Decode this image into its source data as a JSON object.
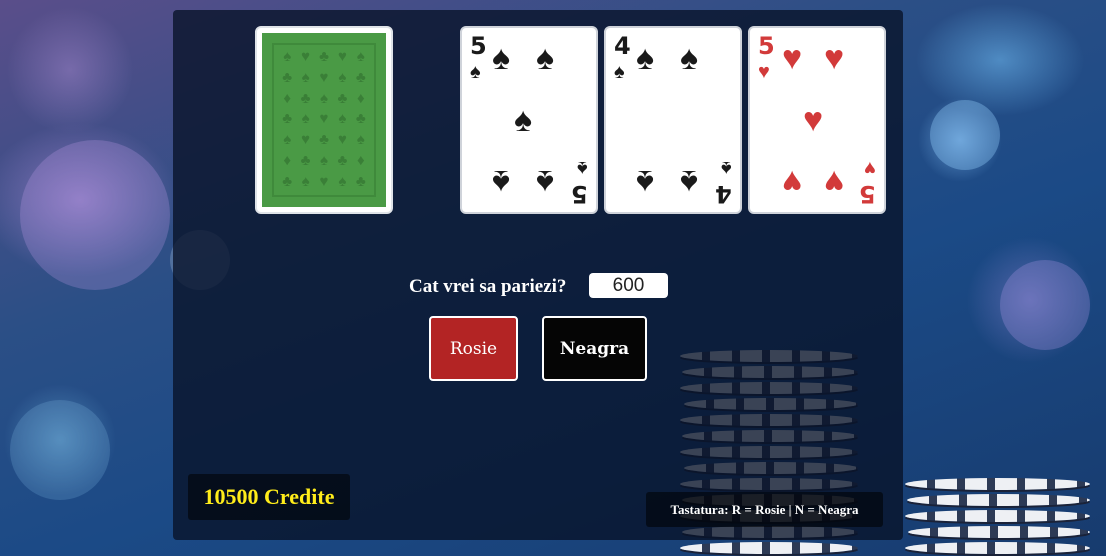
{
  "cards": [
    {
      "id": "back",
      "face_down": true
    },
    {
      "rank": "5",
      "suit": "spades",
      "suit_symbol": "♠",
      "color": "#1a1a1a"
    },
    {
      "rank": "4",
      "suit": "spades",
      "suit_symbol": "♠",
      "color": "#1a1a1a"
    },
    {
      "rank": "5",
      "suit": "hearts",
      "suit_symbol": "♥",
      "color": "#d23a3a"
    }
  ],
  "bet": {
    "label": "Cat vrei sa pariezi?",
    "value": "600"
  },
  "buttons": {
    "red_label": "Rosie",
    "black_label": "Neagra",
    "red_color": "#b32424",
    "black_color": "#050505"
  },
  "credits": {
    "text": "10500 Credite",
    "color": "#ffec1a"
  },
  "keyboard_hint": "Tastatura: R = Rosie | N = Neagra"
}
